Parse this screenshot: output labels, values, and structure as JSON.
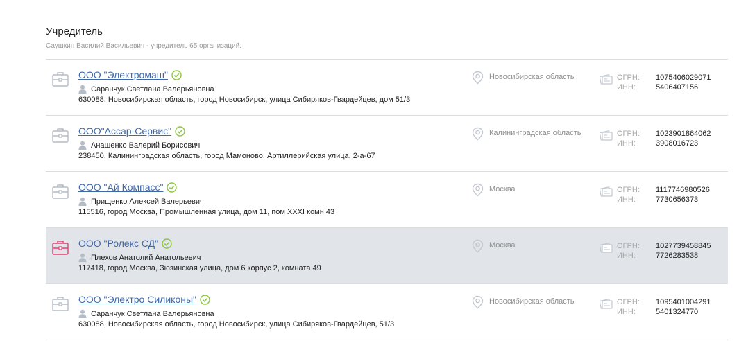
{
  "section": {
    "title": "Учредитель",
    "subtitle": "Саушкин Василий Васильевич - учредитель 65 организаций."
  },
  "labels": {
    "ogrn": "ОГРН:",
    "inn": "ИНН:"
  },
  "colors": {
    "link": "#3f68a9",
    "check": "#8cc63f",
    "icon_gray": "#b4bcc6",
    "icon_active": "#e83f6f",
    "hover_row": "#e1e4e9"
  },
  "organizations": [
    {
      "name": "ООО \"Электромаш\"",
      "person": "Саранчук Светлана Валерьяновна",
      "address": "630088, Новосибирская область, город Новосибирск, улица Сибиряков-Гвардейцев, дом 51/3",
      "region": "Новосибирская область",
      "ogrn": "1075406029071",
      "inn": "5406407156",
      "icon": "briefcase-icon",
      "highlighted": false
    },
    {
      "name": "ООО\"Ассар-Сервис\"",
      "person": "Анашенко Валерий Борисович",
      "address": "238450, Калининградская область, город Мамоново, Артиллерийская улица, 2-а-67",
      "region": "Калининградская область",
      "ogrn": "1023901864062",
      "inn": "3908016723",
      "icon": "briefcase-icon",
      "highlighted": false
    },
    {
      "name": "ООО \"Ай Компасс\"",
      "person": "Прищенко Алексей Валерьевич",
      "address": "115516, город Москва, Промышленная улица, дом 11, пом XXXI комн 43",
      "region": "Москва",
      "ogrn": "1117746980526",
      "inn": "7730656373",
      "icon": "briefcase-icon",
      "highlighted": false
    },
    {
      "name": "ООО \"Ролекс СД\"",
      "person": "Плехов Анатолий Анатольевич",
      "address": "117418, город Москва, Зюзинская улица, дом 6 корпус 2, комната 49",
      "region": "Москва",
      "ogrn": "1027739458845",
      "inn": "7726283538",
      "icon": "briefcase-icon",
      "highlighted": true
    },
    {
      "name": "ООО \"Электро Силиконы\"",
      "person": "Саранчук Светлана Валерьяновна",
      "address": "630088, Новосибирская область, город Новосибирск, улица Сибиряков-Гвардейцев, 51/3",
      "region": "Новосибирская область",
      "ogrn": "1095401004291",
      "inn": "5401324770",
      "icon": "briefcase-icon",
      "highlighted": false
    }
  ]
}
